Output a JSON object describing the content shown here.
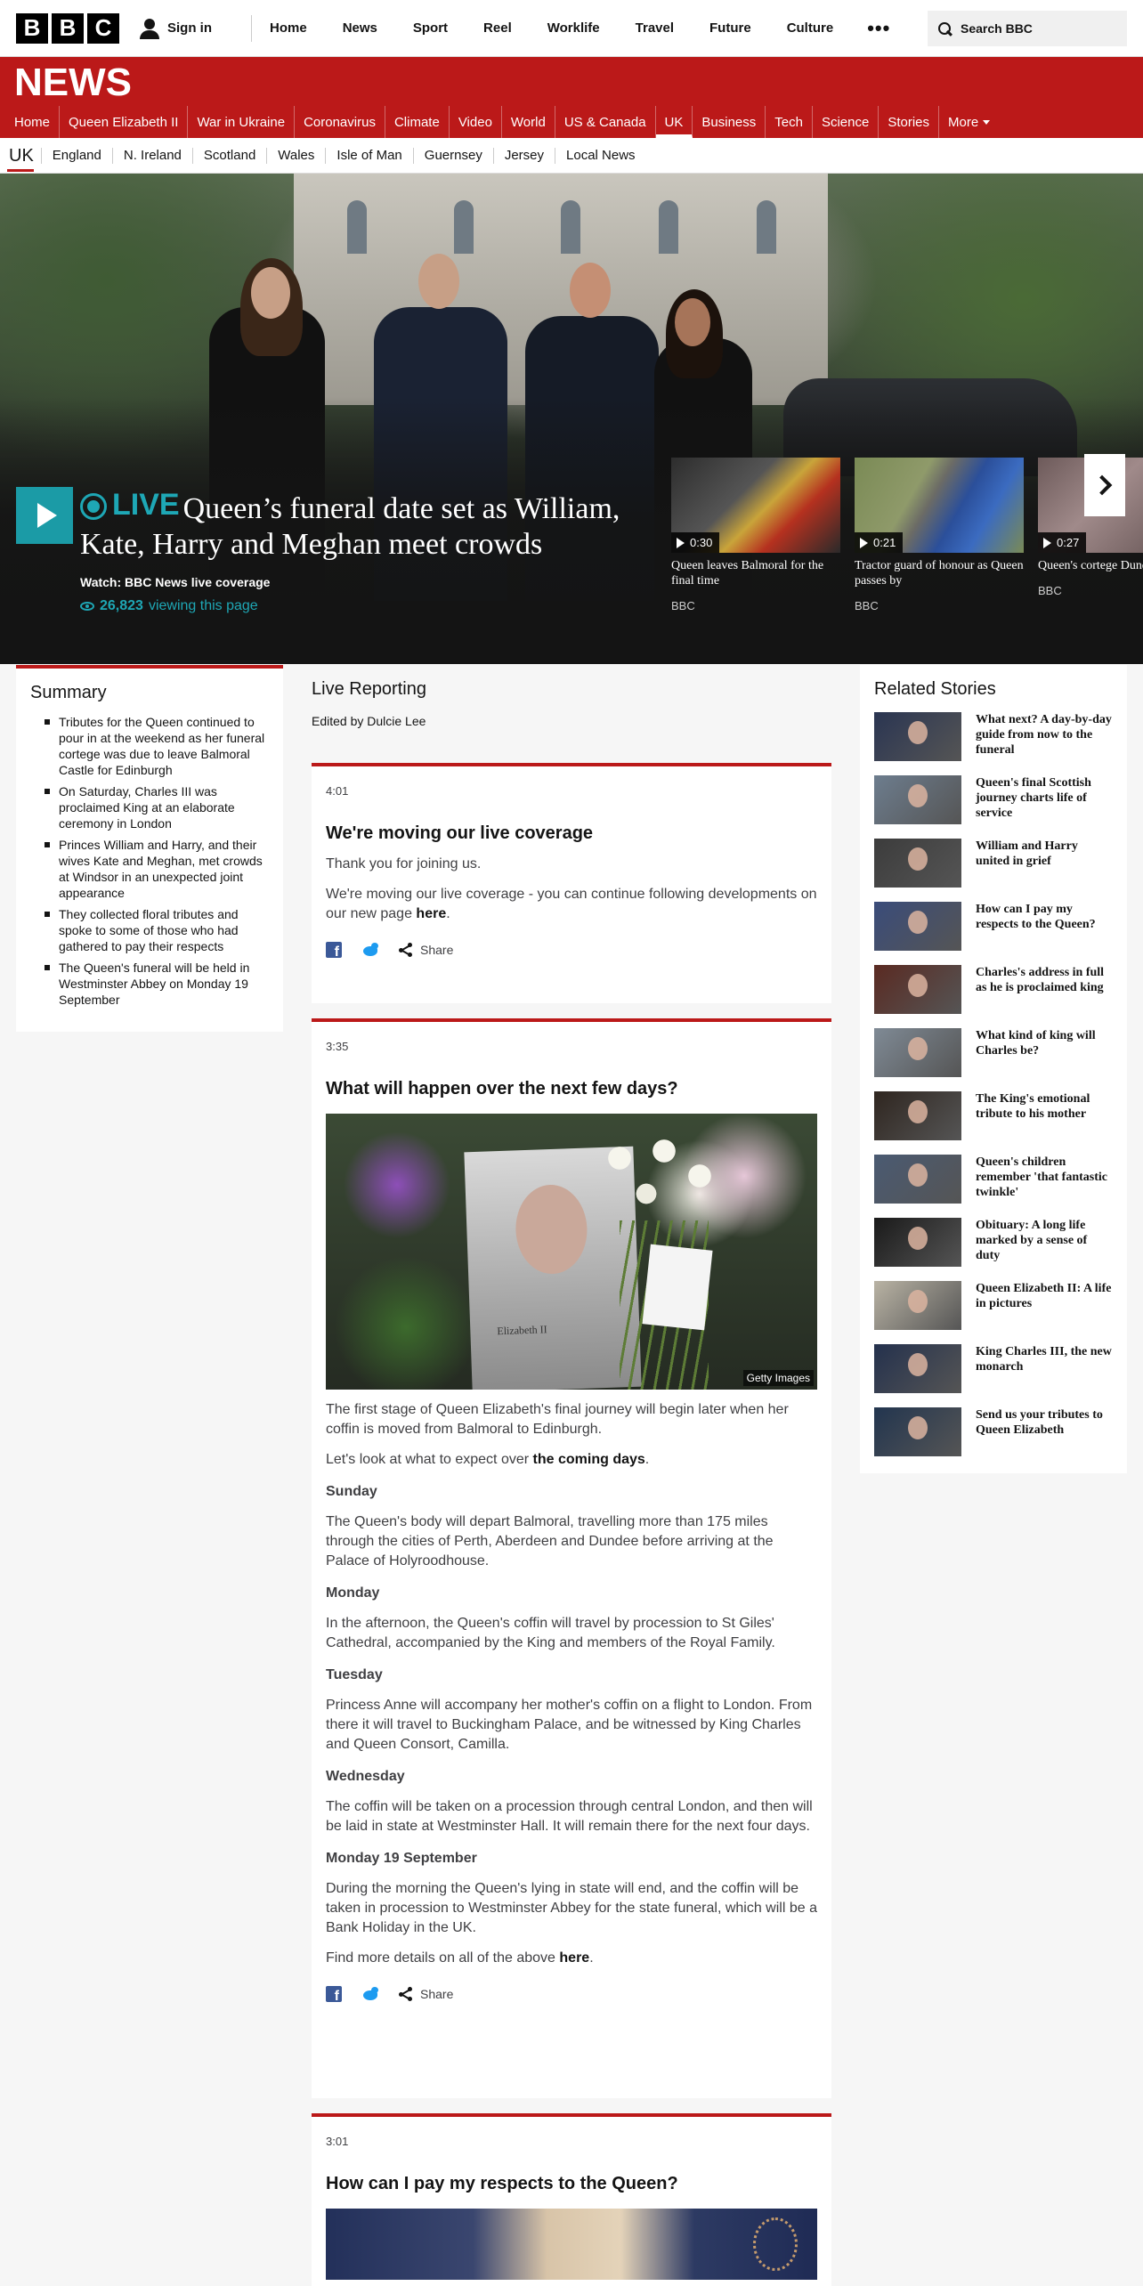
{
  "brand": {
    "letters": [
      "B",
      "B",
      "C"
    ]
  },
  "topbar": {
    "signin": "Sign in",
    "nav": [
      "Home",
      "News",
      "Sport",
      "Reel",
      "Worklife",
      "Travel",
      "Future",
      "Culture"
    ],
    "more": "•••",
    "search_label": "Search BBC"
  },
  "news": {
    "title": "NEWS",
    "nav": [
      "Home",
      "Queen Elizabeth II",
      "War in Ukraine",
      "Coronavirus",
      "Climate",
      "Video",
      "World",
      "US & Canada",
      "UK",
      "Business",
      "Tech",
      "Science",
      "Stories",
      "More"
    ],
    "active": "UK"
  },
  "subnav": {
    "current": "UK",
    "items": [
      "England",
      "N. Ireland",
      "Scotland",
      "Wales",
      "Isle of Man",
      "Guernsey",
      "Jersey",
      "Local News"
    ]
  },
  "hero": {
    "live_label": "LIVE",
    "headline": "Queen’s funeral date set as William, Kate, Harry and Meghan meet crowds",
    "watch": "Watch: BBC News live coverage",
    "viewers_count": "26,823",
    "viewers_suffix": "viewing this page",
    "videos": [
      {
        "duration": "0:30",
        "title": "Queen leaves Balmoral for the final time",
        "source": "BBC"
      },
      {
        "duration": "0:21",
        "title": "Tractor guard of honour as Queen passes by",
        "source": "BBC"
      },
      {
        "duration": "0:27",
        "title": "Queen's cortege Dundee",
        "source": "BBC"
      }
    ]
  },
  "summary": {
    "title": "Summary",
    "items": [
      "Tributes for the Queen continued to pour in at the weekend as her funeral cortege was due to leave Balmoral Castle for Edinburgh",
      "On Saturday, Charles III was proclaimed King at an elaborate ceremony in London",
      "Princes William and Harry, and their wives Kate and Meghan, met crowds at Windsor in an unexpected joint appearance",
      "They collected floral tributes and spoke to some of those who had gathered to pay their respects",
      "The Queen's funeral will be held in Westminster Abbey on Monday 19 September"
    ]
  },
  "live": {
    "title": "Live Reporting",
    "edited": "Edited by Dulcie Lee",
    "share_label": "Share",
    "posts": [
      {
        "time": "4:01",
        "title": "We're moving our live coverage",
        "p1": "Thank you for joining us.",
        "p2": "We're moving our live coverage - you can continue following developments on our new page",
        "p2_link": "here",
        "p2_end": "."
      },
      {
        "time": "3:35",
        "title": "What will happen over the next few days?",
        "image_credit": "Getty Images",
        "portrait_caption": "Elizabeth II",
        "intro": "The first stage of Queen Elizabeth's final journey will begin later when her coffin is moved from Balmoral to Edinburgh.",
        "lookahead": "Let's look at what to expect over",
        "lookahead_link": "the coming days",
        "lookahead_end": ".",
        "days": [
          {
            "day": "Sunday",
            "text": "The Queen's body will depart Balmoral, travelling more than 175 miles through the cities of Perth, Aberdeen and Dundee before arriving at the Palace of Holyroodhouse."
          },
          {
            "day": "Monday",
            "text": "In the afternoon, the Queen's coffin will travel by procession to St Giles' Cathedral, accompanied by the King and members of the Royal Family."
          },
          {
            "day": "Tuesday",
            "text": "Princess Anne will accompany her mother's coffin on a flight to London. From there it will travel to Buckingham Palace, and be witnessed by King Charles and Queen Consort, Camilla."
          },
          {
            "day": "Wednesday",
            "text": "The coffin will be taken on a procession through central London, and then will be laid in state at Westminster Hall. It will remain there for the next four days."
          },
          {
            "day": "Monday 19 September",
            "text": "During the morning the Queen's lying in state will end, and the coffin will be taken in procession to Westminster Abbey for the state funeral, which will be a Bank Holiday in the UK."
          }
        ],
        "more": "Find more details on all of the above",
        "more_link": "here",
        "more_end": "."
      },
      {
        "time": "3:01",
        "title": "How can I pay my respects to the Queen?"
      }
    ]
  },
  "related": {
    "title": "Related Stories",
    "items": [
      {
        "title": "What next? A day-by-day guide from now to the funeral",
        "color": "#2a3552"
      },
      {
        "title": "Queen's final Scottish journey charts life of service",
        "color": "#6d7d8e"
      },
      {
        "title": "William and Harry united in grief",
        "color": "#3c3c3c"
      },
      {
        "title": "How can I pay my respects to the Queen?",
        "color": "#3a4c7a"
      },
      {
        "title": "Charles's address in full as he is proclaimed king",
        "color": "#5a2a22"
      },
      {
        "title": "What kind of king will Charles be?",
        "color": "#7f8a95"
      },
      {
        "title": "The King's emotional tribute to his mother",
        "color": "#2f2620"
      },
      {
        "title": "Queen's children remember 'that fantastic twinkle'",
        "color": "#4a5a72"
      },
      {
        "title": "Obituary: A long life marked by a sense of duty",
        "color": "#1a1a1a"
      },
      {
        "title": "Queen Elizabeth II: A life in pictures",
        "color": "#b9b3a4"
      },
      {
        "title": "King Charles III, the new monarch",
        "color": "#24314d"
      },
      {
        "title": "Send us your tributes to Queen Elizabeth",
        "color": "#22354f"
      }
    ]
  }
}
